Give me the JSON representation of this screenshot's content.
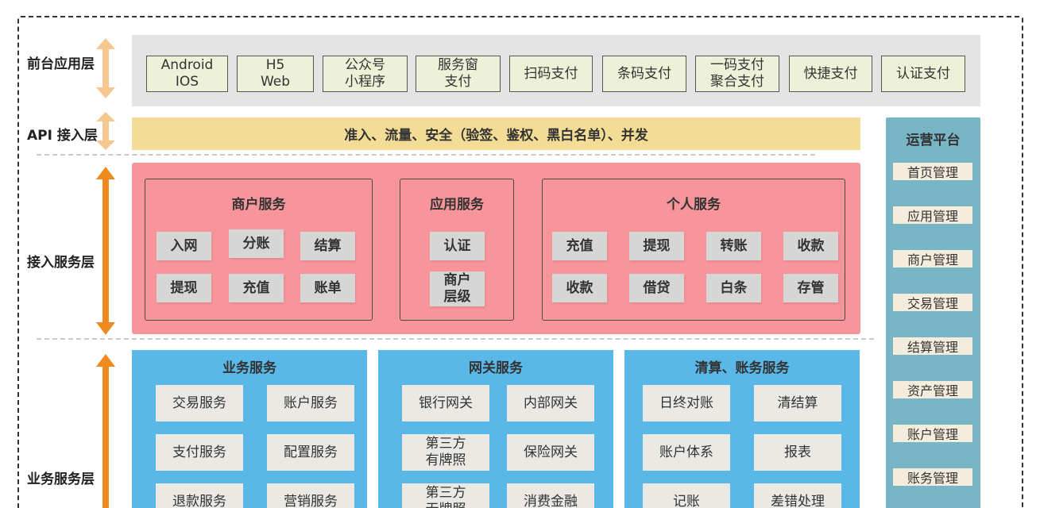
{
  "layers": {
    "front": "前台应用层",
    "api": "API 接入层",
    "access": "接入服务层",
    "business": "业务服务层"
  },
  "front_items": [
    "Android\nIOS",
    "H5\nWeb",
    "公众号\n小程序",
    "服务窗\n支付",
    "扫码支付",
    "条码支付",
    "一码支付\n聚合支付",
    "快捷支付",
    "认证支付"
  ],
  "api_band": "准入、流量、安全（验签、鉴权、黑白名单）、并发",
  "access": {
    "merchant": {
      "title": "商户服务",
      "items": [
        "入网",
        "分账",
        "结算",
        "提现",
        "充值",
        "账单"
      ]
    },
    "application": {
      "title": "应用服务",
      "items": [
        "认证",
        "商户\n层级"
      ]
    },
    "personal": {
      "title": "个人服务",
      "items": [
        "充值",
        "提现",
        "转账",
        "收款",
        "收款",
        "借贷",
        "白条",
        "存管"
      ]
    }
  },
  "business": {
    "biz": {
      "title": "业务服务",
      "items": [
        "交易服务",
        "账户服务",
        "支付服务",
        "配置服务",
        "退款服务",
        "营销服务"
      ]
    },
    "gateway": {
      "title": "网关服务",
      "items": [
        "银行网关",
        "内部网关",
        "第三方\n有牌照",
        "保险网关",
        "第三方\n无牌照",
        "消费金融"
      ]
    },
    "clearing": {
      "title": "清算、账务服务",
      "items": [
        "日终对账",
        "清结算",
        "账户体系",
        "报表",
        "记账",
        "差错处理"
      ]
    }
  },
  "ops": {
    "title": "运营平台",
    "items": [
      "首页管理",
      "应用管理",
      "商户管理",
      "交易管理",
      "结算管理",
      "资产管理",
      "账户管理",
      "账务管理"
    ]
  },
  "colors": {
    "front_band": "#e4e4e4",
    "front_item": "#edf1d8",
    "api_band": "#f3dc95",
    "access_band": "#f7959a",
    "tile": "#d6d6d6",
    "business": "#5ab8e9",
    "ops": "#78b6c6",
    "arrow_light": "#f6c78f",
    "arrow_dark": "#ef8a1f"
  }
}
